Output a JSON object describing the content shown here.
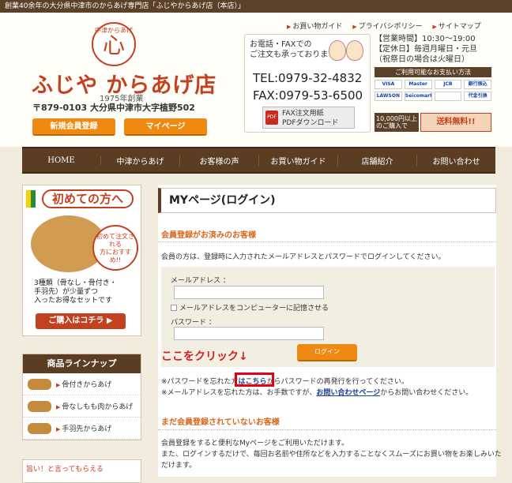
{
  "topbar": {
    "text": "創業40余年の大分県中津市のからあげ専門店「ふじやからあげ店（本店）」"
  },
  "toplinks": [
    "お買い物ガイド",
    "プライバシポリシー",
    "サイトマップ"
  ],
  "logo": {
    "arc": "中津からあげ",
    "kanji": "心",
    "name": "ふじや からあげ店",
    "since": "1975年創業"
  },
  "address": "〒879-0103 大分県中津市大字植野502",
  "header_buttons": {
    "register": "新規会員登録",
    "mypage": "マイページ"
  },
  "contact": {
    "intro": "お電話・FAXでの\nご注文も承っております。",
    "tel": "TEL:0979-32-4832",
    "fax": "FAX:0979-53-6500",
    "fax_button": "FAX注文用紙\nPDFダウンロード",
    "pdf_label": "PDF"
  },
  "info": {
    "hours": "【営業時間】10:30～19:00",
    "holiday": "【定休日】毎週月曜日・元旦",
    "holiday_note": "（祝祭日の場合は火曜日）",
    "payment_header": "ご利用可能なお支払い方法",
    "payments": [
      "VISA",
      "Master",
      "JCB",
      "銀行振込",
      "LAWSON",
      "Seicomart",
      "",
      "代金引換"
    ],
    "shipping_threshold": "10,000円以上\nのご購入で",
    "shipping_free": "送料無料!!"
  },
  "nav": [
    "HOME",
    "中津からあげ",
    "お客様の声",
    "お買い物ガイド",
    "店舗紹介",
    "お問い合わせ"
  ],
  "sidebar": {
    "banner_title": "初めての方へ",
    "banner_rec": "初めて注文される\n方におすすめ!!",
    "banner_text": "3種類（骨なし・骨付き・\n手羽先）が少量ずつ\n入ったお得なセットです",
    "banner_button": "ご購入はコチラ",
    "lineup_title": "商品ラインナップ",
    "lineup_items": [
      "骨付きからあげ",
      "骨なしもも肉からあげ",
      "手羽先からあげ"
    ],
    "promo_text": "旨い！と言ってもらえる"
  },
  "main": {
    "page_title": "MYページ(ログイン)",
    "section1": "会員登録がお済みのお客様",
    "intro": "会員の方は、登録時に入力されたメールアドレスとパスワードでログインしてください。",
    "email_label": "メールアドレス ：",
    "remember": "メールアドレスをコンピューターに記憶させる",
    "password_label": "パスワード ：",
    "login_button": "ログイン",
    "callout": "ここをクリック↓",
    "forgot_pre": "※パスワードを忘れた方",
    "forgot_link": "はこちら",
    "forgot_post": "からパスワードの再発行を行ってください。",
    "mail_pre": "※メールアドレスを忘れた方は、お手数ですが、",
    "mail_link": "お問い合わせページ",
    "mail_post": "からお問い合わせください。",
    "section2": "まだ会員登録されていないお客様",
    "signup1": "会員登録をすると便利なMyページをご利用いただけます。",
    "signup2": "また、ログインするだけで、毎回お名前や住所などを入力することなくスムーズにお買い物をお楽しみいた",
    "signup3": "だけます。"
  }
}
